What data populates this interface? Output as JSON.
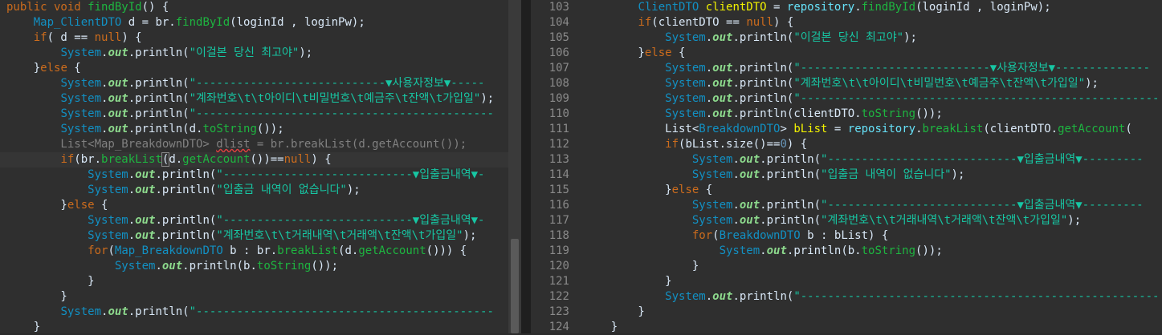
{
  "left_editor": {
    "lines": [
      [
        {
          "c": "k",
          "t": "public void "
        },
        {
          "c": "m",
          "t": "findById"
        },
        {
          "c": "",
          "t": "() {"
        }
      ],
      [
        {
          "c": "",
          "t": "    "
        },
        {
          "c": "t",
          "t": "Map_ClientDTO"
        },
        {
          "c": "",
          "t": " d = br."
        },
        {
          "c": "m",
          "t": "findById"
        },
        {
          "c": "",
          "t": "(loginId , loginPw);"
        }
      ],
      [
        {
          "c": "",
          "t": "    "
        },
        {
          "c": "k",
          "t": "if"
        },
        {
          "c": "",
          "t": "( d == "
        },
        {
          "c": "k",
          "t": "null"
        },
        {
          "c": "",
          "t": ") {"
        }
      ],
      [
        {
          "c": "",
          "t": "        "
        },
        {
          "c": "t",
          "t": "System"
        },
        {
          "c": "",
          "t": "."
        },
        {
          "c": "o",
          "t": "out"
        },
        {
          "c": "",
          "t": ".println("
        },
        {
          "c": "s",
          "t": "\"이걸본 당신 최고야\""
        },
        {
          "c": "",
          "t": ");"
        }
      ],
      [
        {
          "c": "",
          "t": "    }"
        },
        {
          "c": "k",
          "t": "else"
        },
        {
          "c": "",
          "t": " {"
        }
      ],
      [
        {
          "c": "",
          "t": "        "
        },
        {
          "c": "t",
          "t": "System"
        },
        {
          "c": "",
          "t": "."
        },
        {
          "c": "o",
          "t": "out"
        },
        {
          "c": "",
          "t": ".println("
        },
        {
          "c": "s",
          "t": "\"----------------------------▼사용자정보▼-----"
        }
      ],
      [
        {
          "c": "",
          "t": "        "
        },
        {
          "c": "t",
          "t": "System"
        },
        {
          "c": "",
          "t": "."
        },
        {
          "c": "o",
          "t": "out"
        },
        {
          "c": "",
          "t": ".println("
        },
        {
          "c": "s",
          "t": "\"계좌번호\\t\\t아이디\\t비밀번호\\t예금주\\t잔액\\t가입일\""
        },
        {
          "c": "",
          "t": ");"
        }
      ],
      [
        {
          "c": "",
          "t": "        "
        },
        {
          "c": "t",
          "t": "System"
        },
        {
          "c": "",
          "t": "."
        },
        {
          "c": "o",
          "t": "out"
        },
        {
          "c": "",
          "t": ".println("
        },
        {
          "c": "s",
          "t": "\"--------------------------------------------"
        }
      ],
      [
        {
          "c": "",
          "t": "        "
        },
        {
          "c": "t",
          "t": "System"
        },
        {
          "c": "",
          "t": "."
        },
        {
          "c": "o",
          "t": "out"
        },
        {
          "c": "",
          "t": ".println(d."
        },
        {
          "c": "m",
          "t": "toString"
        },
        {
          "c": "",
          "t": "());"
        }
      ],
      [
        {
          "c": "g",
          "t": "        List<Map_BreakdownDTO> "
        },
        {
          "c": "g squig",
          "t": "dlist"
        },
        {
          "c": "g",
          "t": " = br.breakList(d.getAccount());"
        }
      ],
      [
        {
          "c": "",
          "t": "        "
        },
        {
          "c": "k",
          "t": "if"
        },
        {
          "c": "",
          "t": "(br."
        },
        {
          "c": "m",
          "t": "breakList"
        },
        {
          "c": "cursor-box",
          "t": "("
        },
        {
          "c": "",
          "t": "d."
        },
        {
          "c": "m",
          "t": "getAccount"
        },
        {
          "c": "",
          "t": "())=="
        },
        {
          "c": "k",
          "t": "null"
        },
        {
          "c": "",
          "t": ") {"
        }
      ],
      [
        {
          "c": "",
          "t": "            "
        },
        {
          "c": "t",
          "t": "System"
        },
        {
          "c": "",
          "t": "."
        },
        {
          "c": "o",
          "t": "out"
        },
        {
          "c": "",
          "t": ".println("
        },
        {
          "c": "s",
          "t": "\"----------------------------▼입출금내역▼-"
        }
      ],
      [
        {
          "c": "",
          "t": "            "
        },
        {
          "c": "t",
          "t": "System"
        },
        {
          "c": "",
          "t": "."
        },
        {
          "c": "o",
          "t": "out"
        },
        {
          "c": "",
          "t": ".println("
        },
        {
          "c": "s",
          "t": "\"입출금 내역이 없습니다\""
        },
        {
          "c": "",
          "t": ");"
        }
      ],
      [
        {
          "c": "",
          "t": "        }"
        },
        {
          "c": "k",
          "t": "else"
        },
        {
          "c": "",
          "t": " {"
        }
      ],
      [
        {
          "c": "",
          "t": "            "
        },
        {
          "c": "t",
          "t": "System"
        },
        {
          "c": "",
          "t": "."
        },
        {
          "c": "o",
          "t": "out"
        },
        {
          "c": "",
          "t": ".println("
        },
        {
          "c": "s",
          "t": "\"----------------------------▼입출금내역▼-"
        }
      ],
      [
        {
          "c": "",
          "t": "            "
        },
        {
          "c": "t",
          "t": "System"
        },
        {
          "c": "",
          "t": "."
        },
        {
          "c": "o",
          "t": "out"
        },
        {
          "c": "",
          "t": ".println("
        },
        {
          "c": "s",
          "t": "\"계좌번호\\t\\t거래내역\\t거래액\\t잔액\\t가입일\""
        },
        {
          "c": "",
          "t": ");"
        }
      ],
      [
        {
          "c": "",
          "t": "            "
        },
        {
          "c": "k",
          "t": "for"
        },
        {
          "c": "",
          "t": "("
        },
        {
          "c": "t",
          "t": "Map_BreakdownDTO"
        },
        {
          "c": "",
          "t": " b : br."
        },
        {
          "c": "m",
          "t": "breakList"
        },
        {
          "c": "",
          "t": "(d."
        },
        {
          "c": "m",
          "t": "getAccount"
        },
        {
          "c": "",
          "t": "())) {"
        }
      ],
      [
        {
          "c": "",
          "t": "                "
        },
        {
          "c": "t",
          "t": "System"
        },
        {
          "c": "",
          "t": "."
        },
        {
          "c": "o",
          "t": "out"
        },
        {
          "c": "",
          "t": ".println(b."
        },
        {
          "c": "m",
          "t": "toString"
        },
        {
          "c": "",
          "t": "());"
        }
      ],
      [
        {
          "c": "",
          "t": "            }"
        }
      ],
      [
        {
          "c": "",
          "t": "        }"
        }
      ],
      [
        {
          "c": "",
          "t": "        "
        },
        {
          "c": "t",
          "t": "System"
        },
        {
          "c": "",
          "t": "."
        },
        {
          "c": "o",
          "t": "out"
        },
        {
          "c": "",
          "t": ".println("
        },
        {
          "c": "s",
          "t": "\"--------------------------------------------"
        }
      ],
      [
        {
          "c": "",
          "t": "    }"
        }
      ]
    ]
  },
  "right_editor": {
    "line_numbers": [
      "103",
      "104",
      "105",
      "106",
      "107",
      "108",
      "109",
      "110",
      "111",
      "112",
      "113",
      "114",
      "115",
      "116",
      "117",
      "118",
      "119",
      "120",
      "121",
      "122",
      "123",
      "124"
    ],
    "lines": [
      [
        {
          "c": "",
          "t": "        "
        },
        {
          "c": "t",
          "t": "ClientDTO"
        },
        {
          "c": "",
          "t": " "
        },
        {
          "c": "v",
          "t": "clientDTO"
        },
        {
          "c": "",
          "t": " = "
        },
        {
          "c": "fld",
          "t": "repository"
        },
        {
          "c": "",
          "t": "."
        },
        {
          "c": "m",
          "t": "findById"
        },
        {
          "c": "",
          "t": "(loginId , loginPw);"
        }
      ],
      [
        {
          "c": "",
          "t": "        "
        },
        {
          "c": "k",
          "t": "if"
        },
        {
          "c": "",
          "t": "(clientDTO == "
        },
        {
          "c": "k",
          "t": "null"
        },
        {
          "c": "",
          "t": ") {"
        }
      ],
      [
        {
          "c": "",
          "t": "            "
        },
        {
          "c": "t",
          "t": "System"
        },
        {
          "c": "",
          "t": "."
        },
        {
          "c": "o",
          "t": "out"
        },
        {
          "c": "",
          "t": ".println("
        },
        {
          "c": "s",
          "t": "\"이걸본 당신 최고야\""
        },
        {
          "c": "",
          "t": ");"
        }
      ],
      [
        {
          "c": "",
          "t": "        }"
        },
        {
          "c": "k",
          "t": "else"
        },
        {
          "c": "",
          "t": " {"
        }
      ],
      [
        {
          "c": "",
          "t": "            "
        },
        {
          "c": "t",
          "t": "System"
        },
        {
          "c": "",
          "t": "."
        },
        {
          "c": "o",
          "t": "out"
        },
        {
          "c": "",
          "t": ".println("
        },
        {
          "c": "s",
          "t": "\"----------------------------▼사용자정보▼--------------"
        }
      ],
      [
        {
          "c": "",
          "t": "            "
        },
        {
          "c": "t",
          "t": "System"
        },
        {
          "c": "",
          "t": "."
        },
        {
          "c": "o",
          "t": "out"
        },
        {
          "c": "",
          "t": ".println("
        },
        {
          "c": "s",
          "t": "\"계좌번호\\t\\t아이디\\t비밀번호\\t예금주\\t잔액\\t가입일\""
        },
        {
          "c": "",
          "t": ");"
        }
      ],
      [
        {
          "c": "",
          "t": "            "
        },
        {
          "c": "t",
          "t": "System"
        },
        {
          "c": "",
          "t": "."
        },
        {
          "c": "o",
          "t": "out"
        },
        {
          "c": "",
          "t": ".println("
        },
        {
          "c": "s",
          "t": "\"-----------------------------------------------------"
        }
      ],
      [
        {
          "c": "",
          "t": "            "
        },
        {
          "c": "t",
          "t": "System"
        },
        {
          "c": "",
          "t": "."
        },
        {
          "c": "o",
          "t": "out"
        },
        {
          "c": "",
          "t": ".println(clientDTO."
        },
        {
          "c": "m",
          "t": "toString"
        },
        {
          "c": "",
          "t": "());"
        }
      ],
      [
        {
          "c": "",
          "t": "            List<"
        },
        {
          "c": "t",
          "t": "BreakdownDTO"
        },
        {
          "c": "",
          "t": "> "
        },
        {
          "c": "v",
          "t": "bList"
        },
        {
          "c": "",
          "t": " = "
        },
        {
          "c": "fld",
          "t": "repository"
        },
        {
          "c": "",
          "t": "."
        },
        {
          "c": "m",
          "t": "breakList"
        },
        {
          "c": "",
          "t": "(clientDTO."
        },
        {
          "c": "m",
          "t": "getAccount"
        },
        {
          "c": "",
          "t": "("
        }
      ],
      [
        {
          "c": "",
          "t": "            "
        },
        {
          "c": "k",
          "t": "if"
        },
        {
          "c": "",
          "t": "(bList.size()=="
        },
        {
          "c": "n",
          "t": "0"
        },
        {
          "c": "",
          "t": ") {"
        }
      ],
      [
        {
          "c": "",
          "t": "                "
        },
        {
          "c": "t",
          "t": "System"
        },
        {
          "c": "",
          "t": "."
        },
        {
          "c": "o",
          "t": "out"
        },
        {
          "c": "",
          "t": ".println("
        },
        {
          "c": "s",
          "t": "\"----------------------------▼입출금내역▼---------"
        }
      ],
      [
        {
          "c": "",
          "t": "                "
        },
        {
          "c": "t",
          "t": "System"
        },
        {
          "c": "",
          "t": "."
        },
        {
          "c": "o",
          "t": "out"
        },
        {
          "c": "",
          "t": ".println("
        },
        {
          "c": "s",
          "t": "\"입출금 내역이 없습니다\""
        },
        {
          "c": "",
          "t": ");"
        }
      ],
      [
        {
          "c": "",
          "t": "            }"
        },
        {
          "c": "k",
          "t": "else"
        },
        {
          "c": "",
          "t": " {"
        }
      ],
      [
        {
          "c": "",
          "t": "                "
        },
        {
          "c": "t",
          "t": "System"
        },
        {
          "c": "",
          "t": "."
        },
        {
          "c": "o",
          "t": "out"
        },
        {
          "c": "",
          "t": ".println("
        },
        {
          "c": "s",
          "t": "\"----------------------------▼입출금내역▼---------"
        }
      ],
      [
        {
          "c": "",
          "t": "                "
        },
        {
          "c": "t",
          "t": "System"
        },
        {
          "c": "",
          "t": "."
        },
        {
          "c": "o",
          "t": "out"
        },
        {
          "c": "",
          "t": ".println("
        },
        {
          "c": "s",
          "t": "\"계좌번호\\t\\t거래내역\\t거래액\\t잔액\\t가입일\""
        },
        {
          "c": "",
          "t": ");"
        }
      ],
      [
        {
          "c": "",
          "t": "                "
        },
        {
          "c": "k",
          "t": "for"
        },
        {
          "c": "",
          "t": "("
        },
        {
          "c": "t",
          "t": "BreakdownDTO"
        },
        {
          "c": "",
          "t": " b : bList) {"
        }
      ],
      [
        {
          "c": "",
          "t": "                    "
        },
        {
          "c": "t",
          "t": "System"
        },
        {
          "c": "",
          "t": "."
        },
        {
          "c": "o",
          "t": "out"
        },
        {
          "c": "",
          "t": ".println(b."
        },
        {
          "c": "m",
          "t": "toString"
        },
        {
          "c": "",
          "t": "());"
        }
      ],
      [
        {
          "c": "",
          "t": "                }"
        }
      ],
      [
        {
          "c": "",
          "t": "            }"
        }
      ],
      [
        {
          "c": "",
          "t": "            "
        },
        {
          "c": "t",
          "t": "System"
        },
        {
          "c": "",
          "t": "."
        },
        {
          "c": "o",
          "t": "out"
        },
        {
          "c": "",
          "t": ".println("
        },
        {
          "c": "s",
          "t": "\"-----------------------------------------------------"
        }
      ],
      [
        {
          "c": "",
          "t": "        }"
        }
      ],
      [
        {
          "c": "",
          "t": "    }"
        }
      ]
    ]
  },
  "colors": {
    "keyword": "#cc6c1d",
    "method": "#1eb540",
    "type": "#1290c3",
    "string": "#17c6a3",
    "static_field": "#8dda8d",
    "local_var": "#f2f200",
    "field": "#66e1f8",
    "background": "#2f2f2f"
  }
}
